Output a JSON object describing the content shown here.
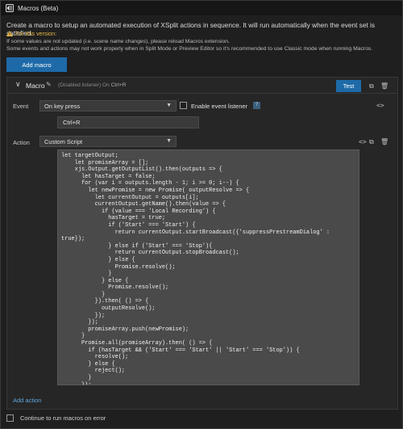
{
  "window": {
    "title": "Macros (Beta)"
  },
  "intro": "Create a macro to setup an automated execution of XSplit actions in sequence. It will run automatically when the event set is satisfied.",
  "warning_label": "For this version:",
  "notes": [
    "If some values are not updated (i.e. scene name changes), please reload Macros extension.",
    "Some events and actions may not work properly when in Split Mode or Preview Editor so it's recommended to use Classic mode when running Macros."
  ],
  "add_macro_label": "Add macro",
  "macro": {
    "name": "Macro",
    "status_prefix": "(Disabled listener) On",
    "hotkey_hint": "Ctrl+R",
    "test_label": "Test",
    "event_label": "Event",
    "event_value": "On key press",
    "enable_listener_label": "Enable event listener",
    "help_glyph": "?",
    "key_value": "Ctrl+R",
    "action_label": "Action",
    "action_value": "Custom Script",
    "script": "let targetOutput;\n    let promiseArray = [];\n    xjs.Output.getOutputList().then(outputs => {\n      let hasTarget = false;\n      for (var i = outputs.length - 1; i >= 0; i--) {\n        let newPromise = new Promise( outputResolve => {\n          let currentOutput = outputs[i];\n          currentOutput.getName().then(value => {\n            if (value === 'Local Recording') {\n              hasTarget = true;\n              if ('Start' === 'Start') {\n                return currentOutput.startBroadcast({'suppressPrestreamDialog' :\ntrue});\n              } else if ('Start' === 'Stop'){\n                return currentOutput.stopBroadcast();\n              } else {\n                Promise.resolve();\n              }\n            } else {\n              Promise.resolve();\n            }\n          }).then( () => {\n            outputResolve();\n          });\n        });\n        promiseArray.push(newPromise);\n      }\n      Promise.all(promiseArray).then( () => {\n        if (hasTarget && ('Start' === 'Start' || 'Start' === 'Stop')) {\n          resolve();\n        } else {\n          reject();\n        }\n      });\n    });",
    "add_action_label": "Add action"
  },
  "continue_on_error_label": "Continue to run macros on error",
  "colors": {
    "accent": "#1e6aa8",
    "link": "#5ea6e0",
    "warning": "#e8b84a"
  }
}
